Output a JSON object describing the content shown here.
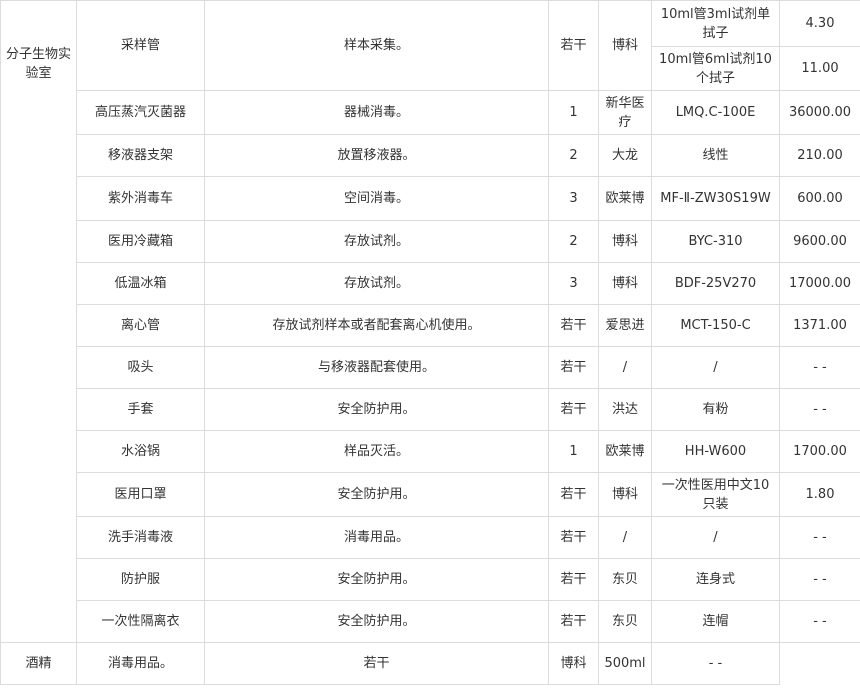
{
  "department": "分子生物实验室",
  "rows": [
    {
      "name": "采样管",
      "use": "样本采集。",
      "qty": "若干",
      "brand": "博科",
      "variants": [
        {
          "model": "10ml管3ml试剂单拭子",
          "price": "4.30"
        },
        {
          "model": "10ml管6ml试剂10个拭子",
          "price": "11.00"
        }
      ]
    },
    {
      "name": "高压蒸汽灭菌器",
      "use": "器械消毒。",
      "qty": "1",
      "brand": "新华医疗",
      "model": "LMQ.C-100E",
      "price": "36000.00"
    },
    {
      "name": "移液器支架",
      "use": "放置移液器。",
      "qty": "2",
      "brand": "大龙",
      "model": "线性",
      "price": "210.00"
    },
    {
      "name": "紫外消毒车",
      "use": "空间消毒。",
      "qty": "3",
      "brand": "欧莱博",
      "model": "MF-Ⅱ-ZW30S19W",
      "price": "600.00"
    },
    {
      "name": "医用冷藏箱",
      "use": "存放试剂。",
      "qty": "2",
      "brand": "博科",
      "model": "BYC-310",
      "price": "9600.00"
    },
    {
      "name": "低温冰箱",
      "use": "存放试剂。",
      "qty": "3",
      "brand": "博科",
      "model": "BDF-25V270",
      "price": "17000.00"
    },
    {
      "name": "离心管",
      "use": "存放试剂样本或者配套离心机使用。",
      "qty": "若干",
      "brand": "爱思进",
      "model": "MCT-150-C",
      "price": "1371.00"
    },
    {
      "name": "吸头",
      "use": "与移液器配套使用。",
      "qty": "若干",
      "brand": "/",
      "model": "/",
      "price": "- -"
    },
    {
      "name": "手套",
      "use": "安全防护用。",
      "qty": "若干",
      "brand": "洪达",
      "model": "有粉",
      "price": "- -"
    },
    {
      "name": "水浴锅",
      "use": "样品灭活。",
      "qty": "1",
      "brand": "欧莱博",
      "model": "HH-W600",
      "price": "1700.00"
    },
    {
      "name": "医用口罩",
      "use": "安全防护用。",
      "qty": "若干",
      "brand": "博科",
      "model": "一次性医用中文10只装",
      "price": "1.80"
    },
    {
      "name": "洗手消毒液",
      "use": "消毒用品。",
      "qty": "若干",
      "brand": "/",
      "model": "/",
      "price": "- -"
    },
    {
      "name": "防护服",
      "use": "安全防护用。",
      "qty": "若干",
      "brand": "东贝",
      "model": "连身式",
      "price": "- -"
    },
    {
      "name": "一次性隔离衣",
      "use": "安全防护用。",
      "qty": "若干",
      "brand": "东贝",
      "model": "连帽",
      "price": "- -"
    },
    {
      "name": "酒精",
      "use": "消毒用品。",
      "qty": "若干",
      "brand": "博科",
      "model": "500ml",
      "price": "- -"
    }
  ]
}
